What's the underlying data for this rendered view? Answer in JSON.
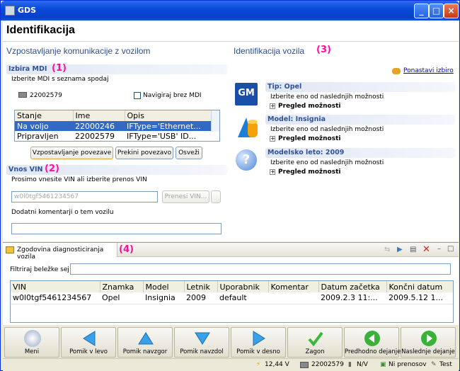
{
  "window": {
    "title": "GDS",
    "min": "_",
    "max": "□",
    "close": "×"
  },
  "header": {
    "title": "Identifikacija"
  },
  "left": {
    "section_title": "Vzpostavljanje komunikacije z vozilom",
    "mdi": {
      "band": "Izbira MDI",
      "marker": "(1)",
      "hint": "Izberite MDI s seznama spodaj",
      "device": "22002579",
      "checkbox_label": "Navigiraj brez MDI",
      "columns": [
        "Stanje",
        "Ime",
        "Opis"
      ],
      "rows": [
        [
          "Na voljo",
          "22000246",
          "IFType='Ethernet..."
        ],
        [
          "Pripravljen",
          "22002579",
          "IFType='USB' ID..."
        ]
      ],
      "btn_connect": "Vzpostavljanje povezave",
      "btn_disconnect": "Prekini povezavo",
      "btn_refresh": "Osveži"
    },
    "vin": {
      "band": "Vnos VIN",
      "marker": "(2)",
      "hint": "Prosimo vnesite VIN ali izberite prenos VIN",
      "value": "w0l0tgf5461234567",
      "btn_transfer": "Prenesi VIN...",
      "comments_label": "Dodatni komentarji o tem vozilu",
      "comments_value": ""
    }
  },
  "right": {
    "section_title": "Identifikacija vozila",
    "marker": "(3)",
    "reset": "Ponastavi izbiro",
    "cards": [
      {
        "title": "Tip: Opel",
        "hint": "Izberite eno od naslednjih možnosti",
        "link": "Pregled možnosti"
      },
      {
        "title": "Model: Insignia",
        "hint": "Izberite eno od naslednjih možnosti",
        "link": "Pregled možnosti"
      },
      {
        "title": "Modelsko leto: 2009",
        "hint": "Izberite eno od naslednjih možnosti",
        "link": "Pregled možnosti"
      }
    ],
    "logo_text": "GM"
  },
  "history": {
    "tab": "Zgodovina diagnosticiranja vozila",
    "marker": "(4)",
    "filter_label": "Filtriraj beležke sej",
    "filter_value": "",
    "columns": [
      "VIN",
      "Znamka",
      "Model",
      "Letnik",
      "Uporabnik",
      "Komentar",
      "Datum začetka",
      "Končni datum"
    ],
    "rows": [
      [
        "w0l0tgf5461234567",
        "Opel",
        "Insignia",
        "2009",
        "default",
        "",
        "2009.2.3 11:...",
        "2009.5.12 1..."
      ]
    ]
  },
  "toolbar": {
    "buttons": [
      "Meni",
      "Pomik v levo",
      "Pomik navzgor",
      "Pomik navzdol",
      "Pomik v desno",
      "Zagon",
      "Predhodno dejanje",
      "Naslednje dejanje"
    ]
  },
  "status": {
    "voltage": "12,44 V",
    "device": "22002579",
    "na": "N/V",
    "transfer": "Ni prenosov",
    "mode": "Test"
  },
  "colors": {
    "accent": "#2f5197",
    "marker": "#ff0ea0",
    "selection": "#316ac5"
  }
}
